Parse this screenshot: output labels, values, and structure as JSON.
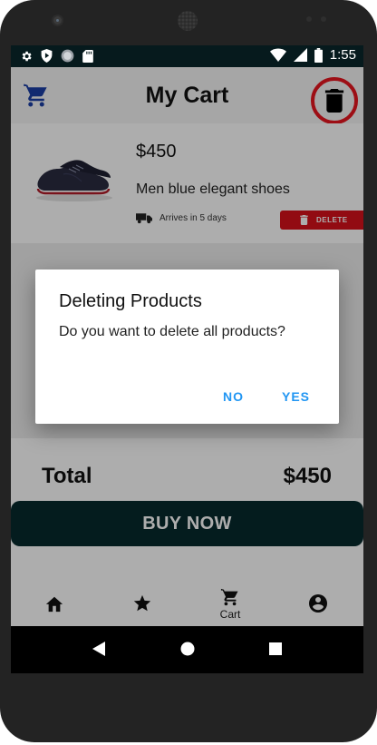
{
  "status_bar": {
    "time": "1:55"
  },
  "app_bar": {
    "title": "My Cart"
  },
  "cart_item": {
    "price": "$450",
    "name": "Men blue elegant shoes",
    "arrival": "Arrives in 5 days",
    "delete_label": "DELETE"
  },
  "summary": {
    "total_label": "Total",
    "total_value": "$450",
    "buy_label": "BUY NOW"
  },
  "bottom_nav": {
    "items": [
      {
        "icon": "home-icon",
        "label": ""
      },
      {
        "icon": "star-icon",
        "label": ""
      },
      {
        "icon": "cart-icon",
        "label": "Cart"
      },
      {
        "icon": "account-icon",
        "label": ""
      }
    ]
  },
  "dialog": {
    "title": "Deleting Products",
    "message": "Do you want to delete all products?",
    "no_label": "NO",
    "yes_label": "YES"
  },
  "colors": {
    "accent": "#2196f3",
    "cart_icon": "#1b3fa6",
    "delete": "#d8111b",
    "highlight_ring": "#e8161f",
    "primary_dark": "#062a2d"
  }
}
